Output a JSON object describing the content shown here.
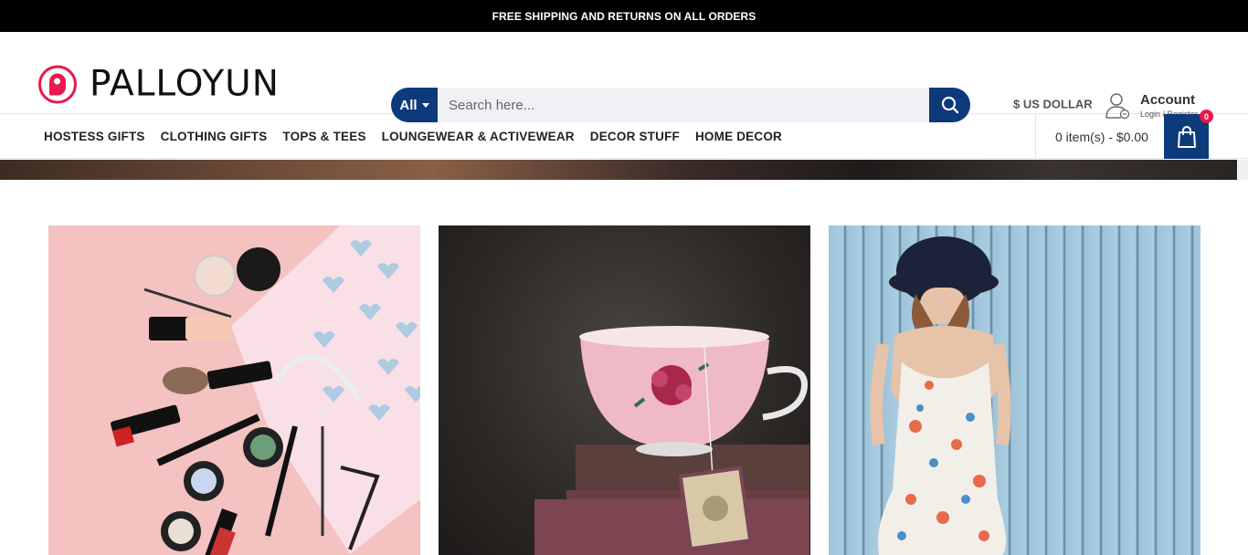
{
  "topbar": {
    "text": "FREE SHIPPING AND RETURNS ON ALL ORDERS"
  },
  "brand": {
    "name": "PALLOYUN",
    "color": "#e8194b"
  },
  "search": {
    "category": "All",
    "placeholder": "Search here...",
    "accent": "#0d3a7b"
  },
  "currency": {
    "label": "$ US DOLLAR"
  },
  "account": {
    "title": "Account",
    "subtitle": "Login / Register"
  },
  "nav": {
    "items": [
      "HOSTESS GIFTS",
      "CLOTHING GIFTS",
      "TOPS & TEES",
      "LOUNGEWEAR & ACTIVEWEAR",
      "DECOR STUFF",
      "HOME DECOR"
    ]
  },
  "cart": {
    "summary": "0 item(s) - $0.00",
    "count": "0"
  },
  "products": [
    {
      "image": "cosmetics-flatlay"
    },
    {
      "image": "pink-teacup-on-books"
    },
    {
      "image": "woman-floral-dress-hat"
    }
  ]
}
